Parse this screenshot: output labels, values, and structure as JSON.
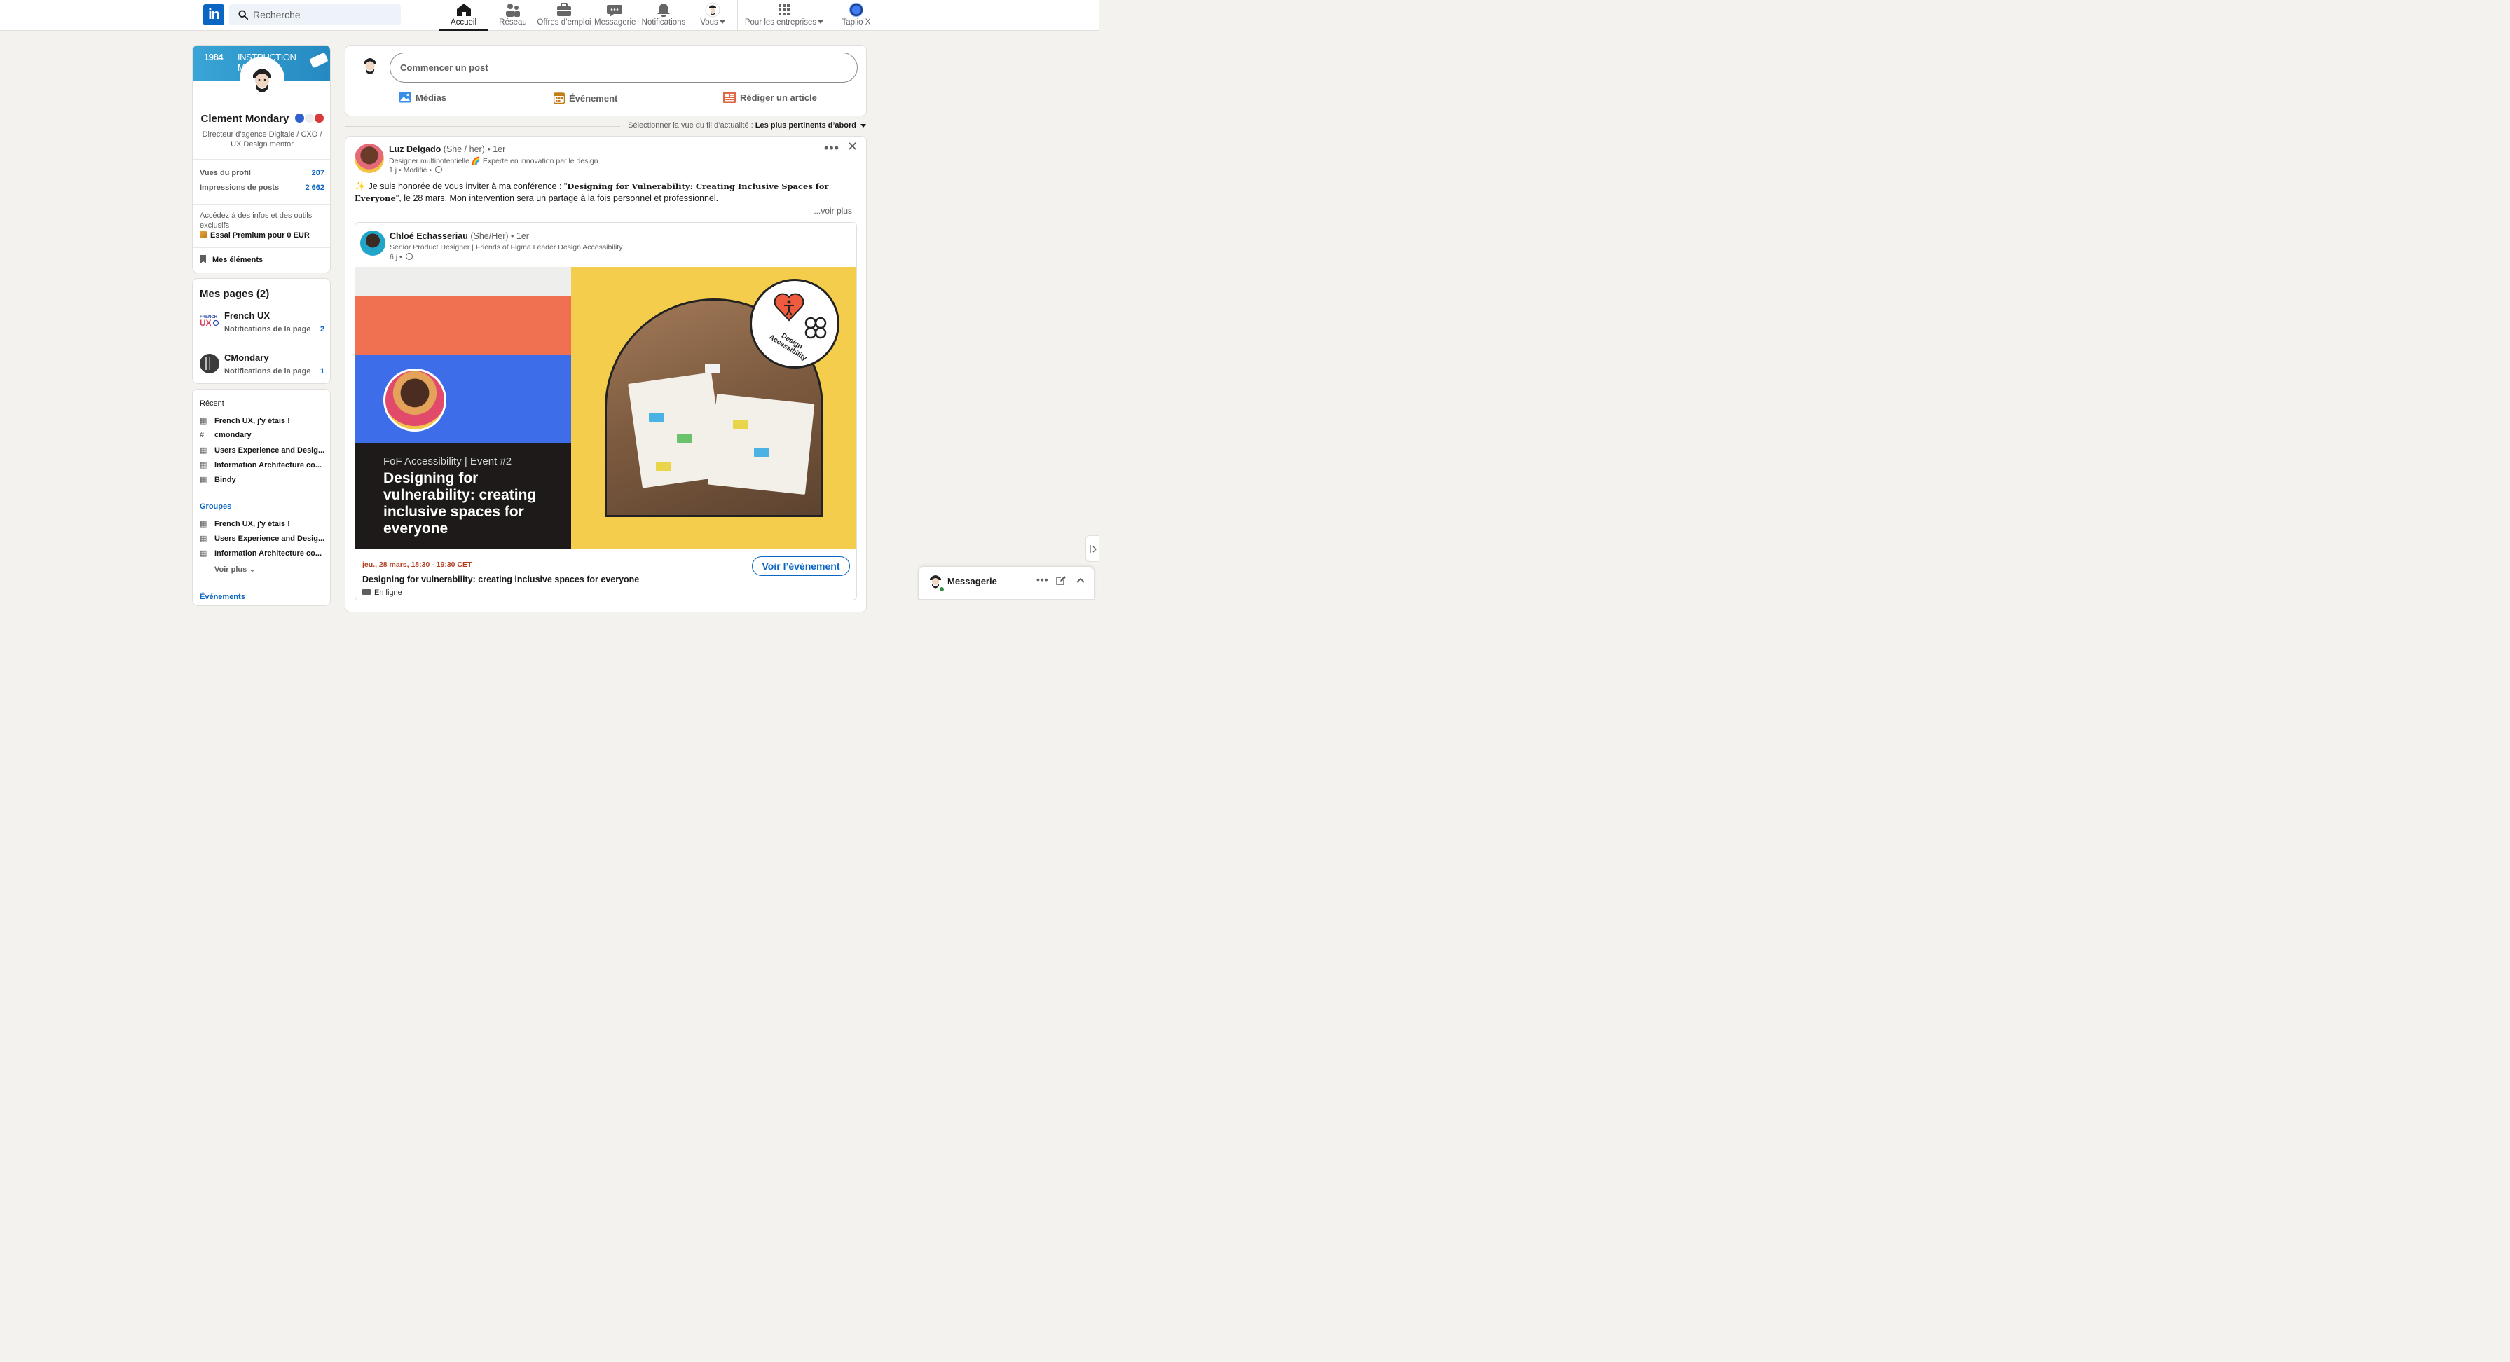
{
  "nav": {
    "logo": "in",
    "search_placeholder": "Recherche",
    "items": [
      {
        "label": "Accueil",
        "icon": "home-icon"
      },
      {
        "label": "Réseau",
        "icon": "network-icon"
      },
      {
        "label": "Offres d’emploi",
        "icon": "briefcase-icon"
      },
      {
        "label": "Messagerie",
        "icon": "message-icon"
      },
      {
        "label": "Notifications",
        "icon": "bell-icon"
      },
      {
        "label": "Vous",
        "icon": "avatar-icon"
      },
      {
        "label": "Pour les entreprises",
        "icon": "grid-icon"
      },
      {
        "label": "Taplio X",
        "icon": "taplio-icon"
      }
    ]
  },
  "profile": {
    "banner_left": "1984",
    "banner_right": "INSTRUCTION MANUAL",
    "name": "Clement Mondary",
    "headline": "Directeur d'agence Digitale / CXO / UX Design mentor",
    "stats": [
      {
        "label": "Vues du profil",
        "value": "207"
      },
      {
        "label": "Impressions de posts",
        "value": "2 662"
      }
    ],
    "premium_text": "Accédez à des infos et des outils exclusifs",
    "premium_link": "Essai Premium pour 0 EUR",
    "my_items": "Mes éléments"
  },
  "pages": {
    "title": "Mes pages (2)",
    "items": [
      {
        "name": "French UX",
        "label": "Notifications de la page",
        "count": "2",
        "logo": "FRENCH UX"
      },
      {
        "name": "CMondary",
        "label": "Notifications de la page",
        "count": "1"
      }
    ]
  },
  "recent": {
    "title": "Récent",
    "items": [
      "French UX, j'y étais !",
      "cmondary",
      "Users Experience and Desig...",
      "Information Architecture co...",
      "Bindy"
    ],
    "groups_title": "Groupes",
    "groups": [
      "French UX, j'y étais !",
      "Users Experience and Desig...",
      "Information Architecture co..."
    ],
    "see_more": "Voir plus",
    "events_title": "Événements"
  },
  "composer": {
    "placeholder": "Commencer un post",
    "media": "Médias",
    "event": "Événement",
    "article": "Rédiger un article"
  },
  "feed_sort": {
    "label": "Sélectionner la vue du fil d’actualité :",
    "value": "Les plus pertinents d’abord"
  },
  "post": {
    "author": "Luz Delgado",
    "pronouns": "(She / her)",
    "degree": "• 1er",
    "subtitle": "Designer multipotentielle 🌈 Experte en innovation par le design",
    "time": "1 j • Modifié •",
    "text_before": "Je suis honorée de vous inviter à ma conférence : \"",
    "text_title": "Designing for Vulnerability: Creating Inclusive Spaces for Everyone",
    "text_after": "\", le 28 mars. Mon intervention sera un partage à la fois personnel et professionnel.",
    "see_more": "...voir plus",
    "shared": {
      "author": "Chloé Echasseriau",
      "pronouns": "(She/Her)",
      "degree": "• 1er",
      "subtitle": "Senior Product Designer | Friends of Figma Leader Design Accessibility",
      "time": "6 j •",
      "visual_event": "FoF Accessibility | Event #2",
      "visual_title": "Designing for vulnerability: creating inclusive spaces for everyone",
      "badge_text": "Design Accessibility",
      "event_date": "jeu., 28 mars, 18:30 - 19:30 CET",
      "event_title": "Designing for vulnerability: creating inclusive spaces for everyone",
      "event_mode": "En ligne",
      "cta": "Voir l’événement"
    }
  },
  "messaging": {
    "title": "Messagerie"
  },
  "colors": {
    "brand": "#0a66c2",
    "background": "#f4f2ee",
    "event_orange": "#ef7152",
    "event_blue": "#3d6de8",
    "event_yellow": "#f5cd4c"
  }
}
